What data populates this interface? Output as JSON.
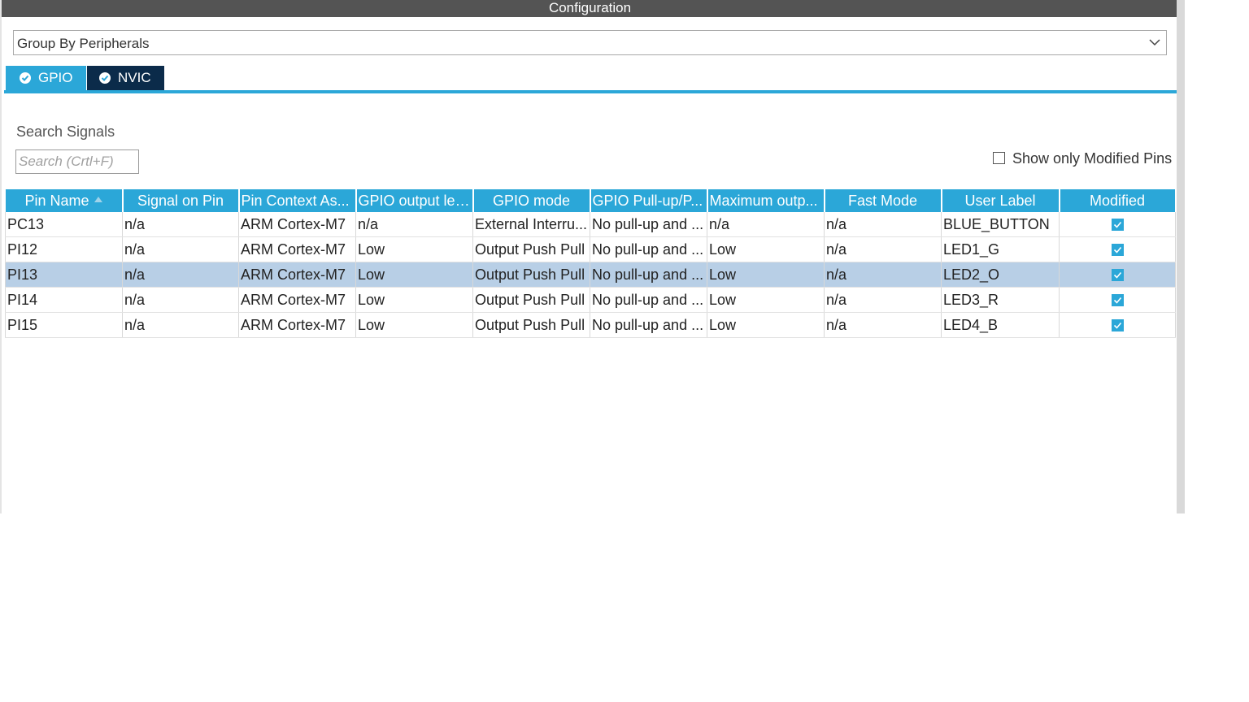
{
  "window": {
    "title": "Configuration"
  },
  "group_by": {
    "value": "Group By Peripherals"
  },
  "tabs": [
    {
      "label": "GPIO",
      "active": true
    },
    {
      "label": "NVIC",
      "active": false
    }
  ],
  "search": {
    "label": "Search Signals",
    "placeholder": "Search (Crtl+F)"
  },
  "modified_filter": {
    "label": "Show only Modified Pins",
    "checked": false
  },
  "table": {
    "columns": [
      "Pin Name",
      "Signal on Pin",
      "Pin Context As...",
      "GPIO output level",
      "GPIO mode",
      "GPIO Pull-up/P...",
      "Maximum outp...",
      "Fast Mode",
      "User Label",
      "Modified"
    ],
    "sort_column": "Pin Name",
    "rows": [
      {
        "pin": "PC13",
        "signal": "n/a",
        "context": "ARM Cortex-M7",
        "level": "n/a",
        "mode": "External Interru...",
        "pull": "No pull-up and ...",
        "max": "n/a",
        "fast": "n/a",
        "label": "BLUE_BUTTON",
        "modified": true,
        "selected": false
      },
      {
        "pin": "PI12",
        "signal": "n/a",
        "context": "ARM Cortex-M7",
        "level": "Low",
        "mode": "Output Push Pull",
        "pull": "No pull-up and ...",
        "max": "Low",
        "fast": "n/a",
        "label": "LED1_G",
        "modified": true,
        "selected": false
      },
      {
        "pin": "PI13",
        "signal": "n/a",
        "context": "ARM Cortex-M7",
        "level": "Low",
        "mode": "Output Push Pull",
        "pull": "No pull-up and ...",
        "max": "Low",
        "fast": "n/a",
        "label": "LED2_O",
        "modified": true,
        "selected": true
      },
      {
        "pin": "PI14",
        "signal": "n/a",
        "context": "ARM Cortex-M7",
        "level": "Low",
        "mode": "Output Push Pull",
        "pull": "No pull-up and ...",
        "max": "Low",
        "fast": "n/a",
        "label": "LED3_R",
        "modified": true,
        "selected": false
      },
      {
        "pin": "PI15",
        "signal": "n/a",
        "context": "ARM Cortex-M7",
        "level": "Low",
        "mode": "Output Push Pull",
        "pull": "No pull-up and ...",
        "max": "Low",
        "fast": "n/a",
        "label": "LED4_B",
        "modified": true,
        "selected": false
      }
    ]
  },
  "colors": {
    "accent": "#2ba7d8",
    "tab_inactive": "#0b2b4a",
    "title_bar": "#545454",
    "row_selected": "#b8cfe6"
  },
  "icons": {
    "tab_status": "check-circle-icon",
    "dropdown": "chevron-down-icon",
    "sort": "sort-up-icon",
    "modified": "checkbox-checked-icon"
  }
}
